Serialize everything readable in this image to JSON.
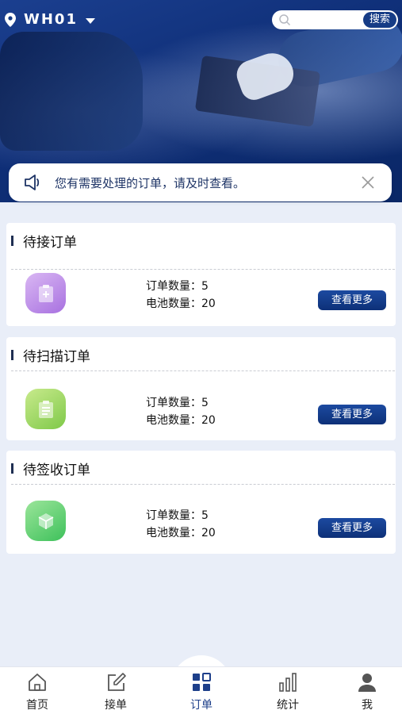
{
  "header": {
    "location_code": "WH01",
    "search": {
      "placeholder": "",
      "button_label": "搜索"
    }
  },
  "notice": {
    "text": "您有需要处理的订单，请及时查看。"
  },
  "cards": [
    {
      "title": "待接订单",
      "order_count_label": "订单数量：5",
      "battery_count_label": "电池数量：20",
      "button_label": "查看更多",
      "icon": "clipboard-plus-icon",
      "color": "#b98be8"
    },
    {
      "title": "待扫描订单",
      "order_count_label": "订单数量：5",
      "battery_count_label": "电池数量：20",
      "button_label": "查看更多",
      "icon": "clipboard-list-icon",
      "color": "#9fd66a"
    },
    {
      "title": "待签收订单",
      "order_count_label": "订单数量：5",
      "battery_count_label": "电池数量：20",
      "button_label": "查看更多",
      "icon": "box-icon",
      "color": "#5acd6e"
    }
  ],
  "tabbar": {
    "items": [
      {
        "label": "首页",
        "icon": "home-icon"
      },
      {
        "label": "接单",
        "icon": "edit-icon"
      },
      {
        "label": "订单",
        "icon": "grid-icon",
        "active": true
      },
      {
        "label": "统计",
        "icon": "bar-chart-icon"
      },
      {
        "label": "我",
        "icon": "user-icon"
      }
    ]
  },
  "colors": {
    "primary": "#163c86",
    "background": "#e9eef8"
  }
}
